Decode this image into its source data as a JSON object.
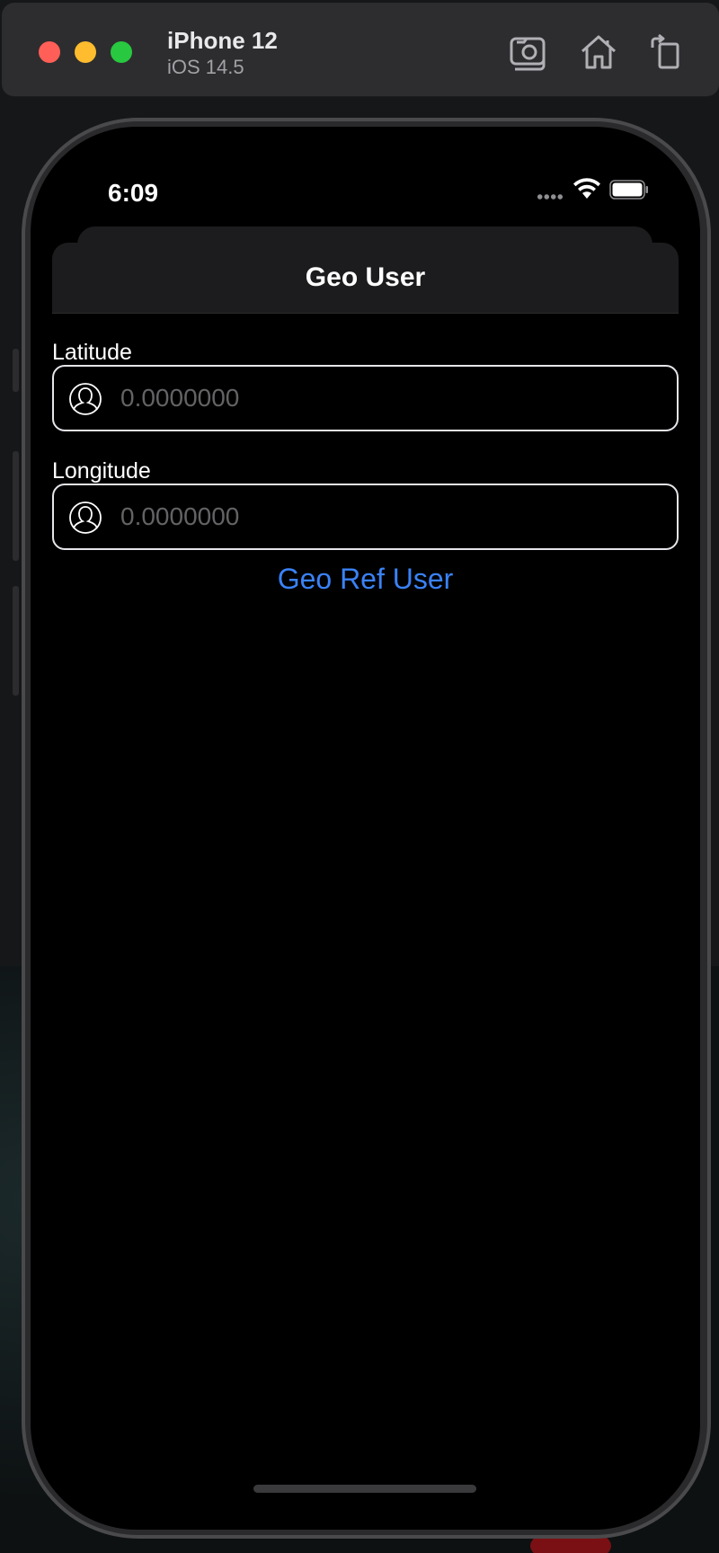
{
  "simulator": {
    "device_name": "iPhone 12",
    "os_version": "iOS 14.5",
    "toolbar": [
      "screenshot-icon",
      "home-icon",
      "rotate-icon"
    ]
  },
  "status_bar": {
    "time": "6:09"
  },
  "nav": {
    "title": "Geo User"
  },
  "form": {
    "latitude": {
      "label": "Latitude",
      "value": "",
      "placeholder": "0.0000000",
      "icon": "user-icon"
    },
    "longitude": {
      "label": "Longitude",
      "value": "",
      "placeholder": "0.0000000",
      "icon": "user-icon"
    },
    "submit_label": "Geo Ref User"
  },
  "colors": {
    "accent": "#3a82f6",
    "background": "#000000",
    "nav_background": "#1c1c1e"
  }
}
